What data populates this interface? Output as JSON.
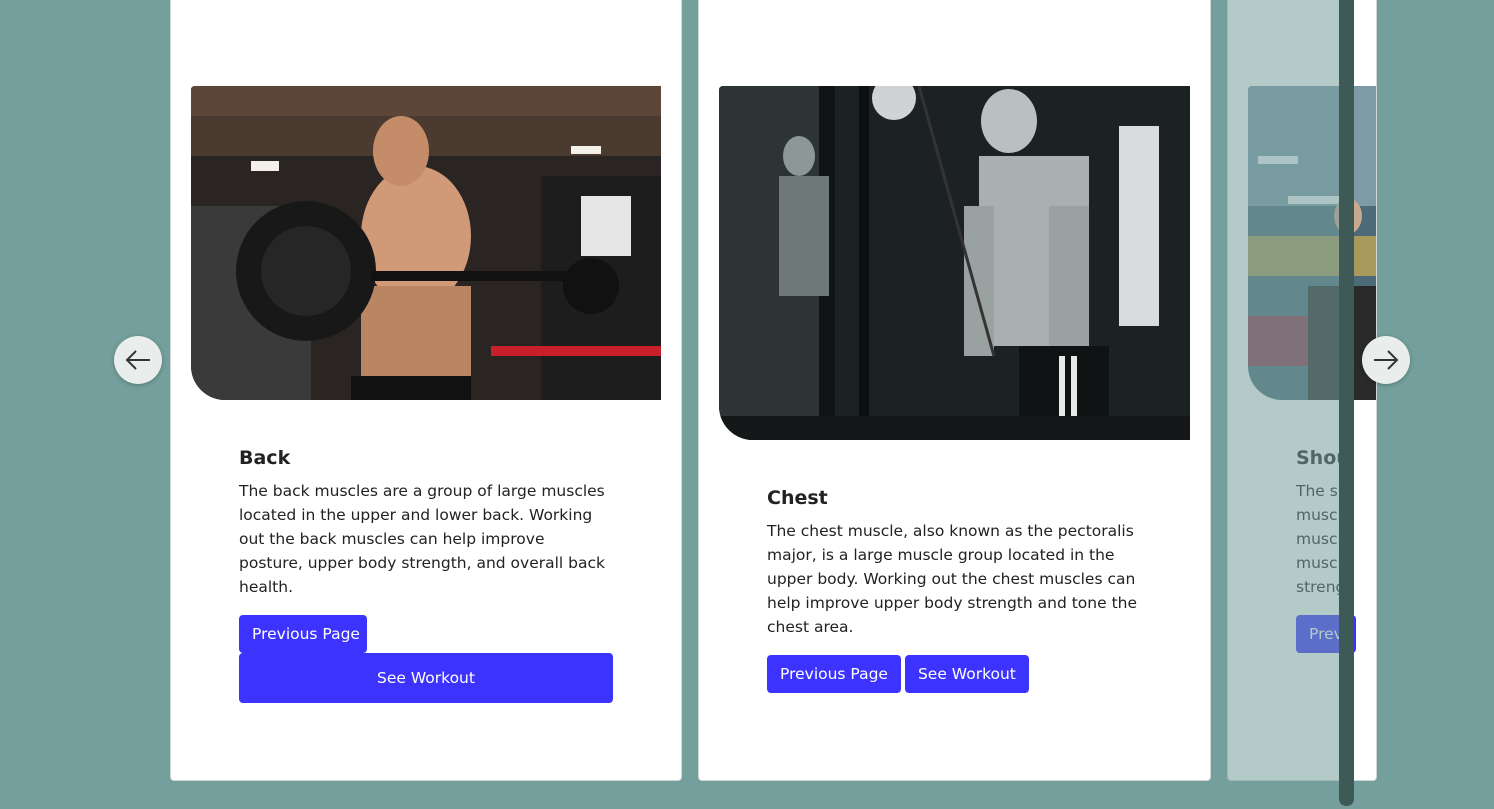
{
  "cards": [
    {
      "title": "Back",
      "text": "The back muscles are a group of large muscles located in the upper and lower back. Working out the back muscles can help improve posture, upper body strength, and overall back health.",
      "prev_label": "Previous Page",
      "see_label": "See Workout"
    },
    {
      "title": "Chest",
      "text": "The chest muscle, also known as the pectoralis major, is a large muscle group located in the upper body. Working out the chest muscles can help improve upper body strength and tone the chest area.",
      "prev_label": "Previous Page",
      "see_label": "See Workout"
    },
    {
      "title": "Shou",
      "text_lines": [
        "The sh",
        "muscl",
        "muscl",
        "muscl",
        "streng"
      ],
      "prev_label": "Prev"
    }
  ],
  "nav": {
    "left_icon": "arrow-left-icon",
    "right_icon": "arrow-right-icon"
  },
  "colors": {
    "background": "#749f9c",
    "button": "#3d33ff",
    "card": "#ffffff"
  }
}
